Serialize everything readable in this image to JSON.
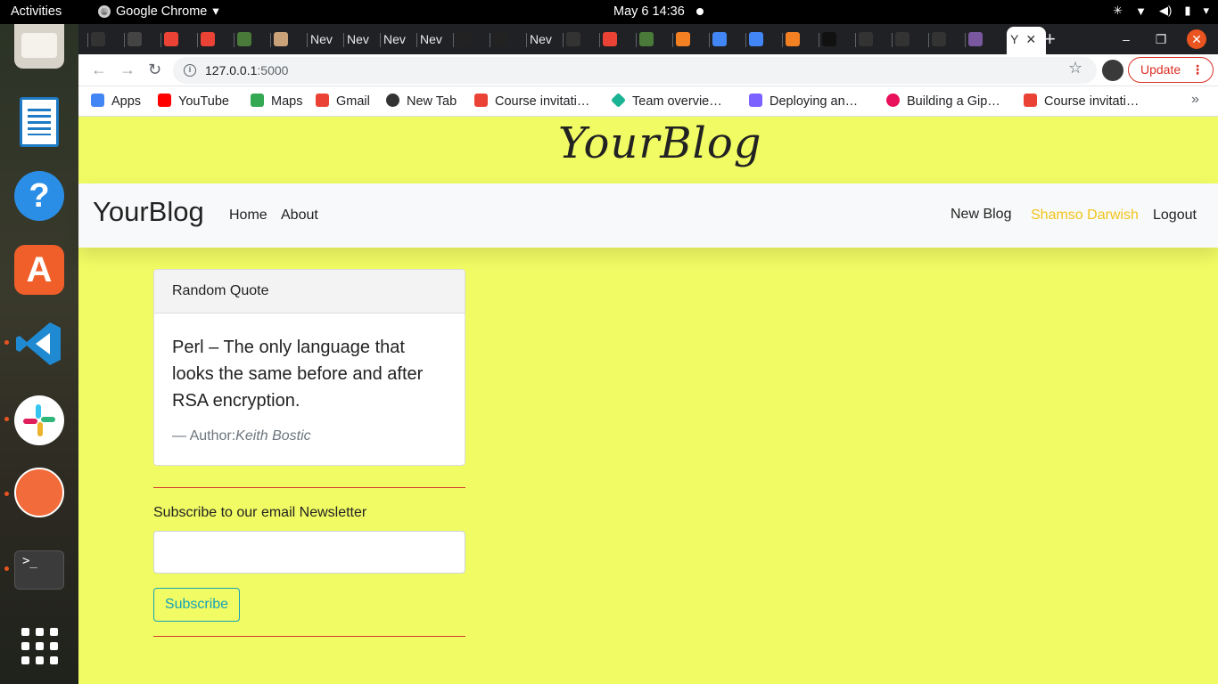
{
  "topbar": {
    "activities": "Activities",
    "app_name": "Google Chrome",
    "app_arrow": "▾",
    "clock": "May 6  14:36"
  },
  "dock": {
    "items": [
      "files",
      "writer",
      "help",
      "app-store",
      "vscode",
      "slack",
      "postman",
      "terminal",
      "show-apps"
    ],
    "terminal_prompt": ">_"
  },
  "browser": {
    "tabs": [
      {
        "label": "",
        "icon": "github-icon",
        "color": "#333"
      },
      {
        "label": "",
        "icon": "github-icon",
        "color": "#444"
      },
      {
        "label": "",
        "icon": "gmail-icon",
        "color": "#ea4335"
      },
      {
        "label": "",
        "icon": "gmail-icon",
        "color": "#ea4335"
      },
      {
        "label": "",
        "icon": "tree-icon",
        "color": "#4a7a3a"
      },
      {
        "label": "",
        "icon": "avatar-icon",
        "color": "#c9a27a"
      },
      {
        "label": "Nev",
        "icon": "",
        "color": ""
      },
      {
        "label": "Nev",
        "icon": "",
        "color": ""
      },
      {
        "label": "Nev",
        "icon": "",
        "color": ""
      },
      {
        "label": "Nev",
        "icon": "",
        "color": ""
      },
      {
        "label": "",
        "icon": "angular-icon",
        "color": "#222"
      },
      {
        "label": "",
        "icon": "angular-icon",
        "color": "#222"
      },
      {
        "label": "Nev",
        "icon": "",
        "color": ""
      },
      {
        "label": "",
        "icon": "github-icon",
        "color": "#333"
      },
      {
        "label": "",
        "icon": "gmail-icon",
        "color": "#ea4335"
      },
      {
        "label": "",
        "icon": "tree-icon",
        "color": "#4a7a3a"
      },
      {
        "label": "",
        "icon": "stackoverflow-icon",
        "color": "#f48024"
      },
      {
        "label": "",
        "icon": "google-icon",
        "color": "#4285f4"
      },
      {
        "label": "",
        "icon": "google-icon",
        "color": "#4285f4"
      },
      {
        "label": "",
        "icon": "stackoverflow-icon",
        "color": "#f48024"
      },
      {
        "label": "",
        "icon": "github-icon",
        "color": "#111"
      },
      {
        "label": "",
        "icon": "github-icon",
        "color": "#333"
      },
      {
        "label": "",
        "icon": "github-icon",
        "color": "#333"
      },
      {
        "label": "",
        "icon": "github-icon",
        "color": "#333"
      },
      {
        "label": "",
        "icon": "heroku-icon",
        "color": "#79589f"
      },
      {
        "label": "Y",
        "icon": "",
        "color": ""
      }
    ],
    "active_tab_close": "✕",
    "new_tab": "+",
    "url_host": "127.0.0.1",
    "url_port": ":5000",
    "update_label": "Update",
    "update_menu": "⋮",
    "bookmarks": [
      {
        "label": "Apps",
        "icon": "apps-grid-icon",
        "color": "#4285f4"
      },
      {
        "label": "YouTube",
        "icon": "youtube-icon",
        "color": "#ff0000"
      },
      {
        "label": "Maps",
        "icon": "maps-pin-icon",
        "color": "#34a853"
      },
      {
        "label": "Gmail",
        "icon": "gmail-icon",
        "color": "#ea4335"
      },
      {
        "label": "New Tab",
        "icon": "globe-icon",
        "color": "#333"
      },
      {
        "label": "Course invitati…",
        "icon": "gmail-icon",
        "color": "#ea4335"
      },
      {
        "label": "Team overvie…",
        "icon": "diamond-icon",
        "color": "#1ab394"
      },
      {
        "label": "Deploying an…",
        "icon": "doc-icon",
        "color": "#7b61ff"
      },
      {
        "label": "Building a Gip…",
        "icon": "record-icon",
        "color": "#e8105b"
      },
      {
        "label": "Course invitati…",
        "icon": "gmail-icon",
        "color": "#ea4335"
      }
    ],
    "bookmarks_more": "»"
  },
  "site": {
    "brand_script": "YourBlog",
    "nav": {
      "brand": "YourBlog",
      "home": "Home",
      "about": "About",
      "new_blog": "New Blog",
      "user": "Shamso Darwish",
      "logout": "Logout"
    },
    "quote_card": {
      "header": "Random Quote",
      "text": "Perl – The only language that looks the same before and after RSA encryption.",
      "footer_prefix": "— Author:",
      "author": "Keith Bostic"
    },
    "newsletter": {
      "label": "Subscribe to our email Newsletter",
      "email_value": "",
      "button": "Subscribe"
    },
    "colors": {
      "page_bg": "#f1fb63",
      "user_link": "#f0c419",
      "subscribe_accent": "#17a2b8",
      "divider": "#d23b2b"
    }
  }
}
